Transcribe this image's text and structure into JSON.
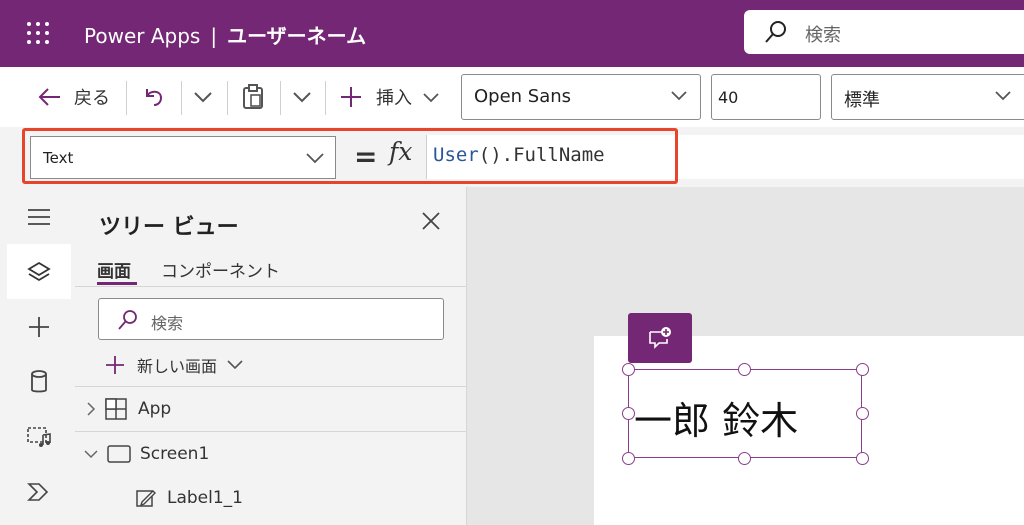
{
  "topbar": {
    "product": "Power Apps",
    "separator": "|",
    "app_name": "ユーザーネーム",
    "search_placeholder": "検索"
  },
  "commandbar": {
    "back_label": "戻る",
    "insert_label": "挿入",
    "font_value": "Open Sans",
    "font_size_value": "40",
    "weight_value": "標準"
  },
  "formula_bar": {
    "property": "Text",
    "equals": "=",
    "fx": "fx",
    "formula_func": "User",
    "formula_rest": "().FullName"
  },
  "tree_view": {
    "title": "ツリー ビュー",
    "tabs": [
      "画面",
      "コンポーネント"
    ],
    "search_placeholder": "検索",
    "new_screen_label": "新しい画面",
    "items": [
      "App",
      "Screen1",
      "Label1_1"
    ]
  },
  "canvas": {
    "label_text": "一郎 鈴木"
  },
  "colors": {
    "brand": "#742774",
    "highlight": "#e8442a",
    "formula_keyword": "#2b5797"
  }
}
